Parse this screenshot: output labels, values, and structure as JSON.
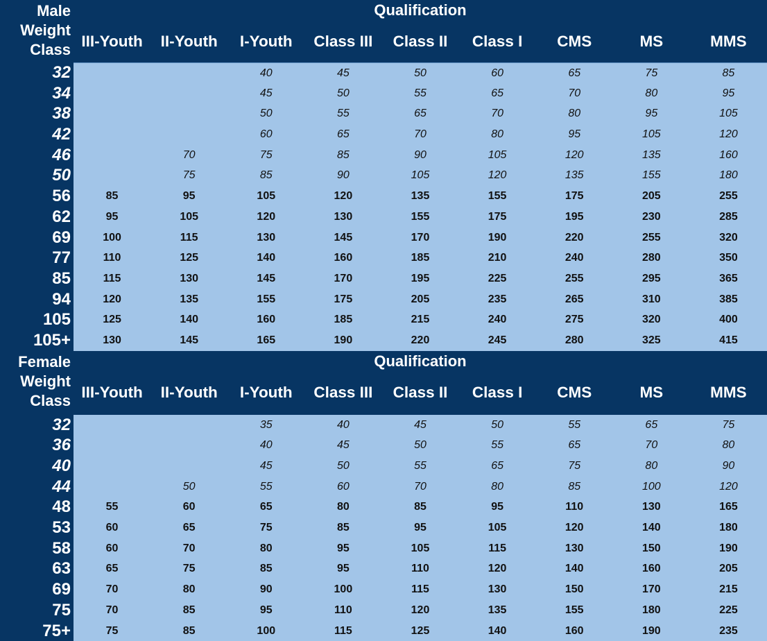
{
  "colors": {
    "header_bg": "#073563",
    "body_bg": "#a2c5e8",
    "header_text": "#ffffff",
    "cell_text": "#111111"
  },
  "qualification_title": "Qualification",
  "columns": [
    "III-Youth",
    "II-Youth",
    "I-Youth",
    "Class III",
    "Class II",
    "Class I",
    "CMS",
    "MS",
    "MMS"
  ],
  "male": {
    "label_lines": [
      "Male",
      "Weight",
      "Class"
    ],
    "qualification_title": "Qualification",
    "rows": [
      {
        "weight": "32",
        "style": "italic",
        "values": [
          "",
          "",
          "40",
          "45",
          "50",
          "60",
          "65",
          "75",
          "85"
        ]
      },
      {
        "weight": "34",
        "style": "italic",
        "values": [
          "",
          "",
          "45",
          "50",
          "55",
          "65",
          "70",
          "80",
          "95"
        ]
      },
      {
        "weight": "38",
        "style": "italic",
        "values": [
          "",
          "",
          "50",
          "55",
          "65",
          "70",
          "80",
          "95",
          "105"
        ]
      },
      {
        "weight": "42",
        "style": "italic",
        "values": [
          "",
          "",
          "60",
          "65",
          "70",
          "80",
          "95",
          "105",
          "120"
        ]
      },
      {
        "weight": "46",
        "style": "italic",
        "values": [
          "",
          "70",
          "75",
          "85",
          "90",
          "105",
          "120",
          "135",
          "160"
        ]
      },
      {
        "weight": "50",
        "style": "italic",
        "values": [
          "",
          "75",
          "85",
          "90",
          "105",
          "120",
          "135",
          "155",
          "180"
        ]
      },
      {
        "weight": "56",
        "style": "bold",
        "values": [
          "85",
          "95",
          "105",
          "120",
          "135",
          "155",
          "175",
          "205",
          "255"
        ]
      },
      {
        "weight": "62",
        "style": "bold",
        "values": [
          "95",
          "105",
          "120",
          "130",
          "155",
          "175",
          "195",
          "230",
          "285"
        ]
      },
      {
        "weight": "69",
        "style": "bold",
        "values": [
          "100",
          "115",
          "130",
          "145",
          "170",
          "190",
          "220",
          "255",
          "320"
        ]
      },
      {
        "weight": "77",
        "style": "bold",
        "values": [
          "110",
          "125",
          "140",
          "160",
          "185",
          "210",
          "240",
          "280",
          "350"
        ]
      },
      {
        "weight": "85",
        "style": "bold",
        "values": [
          "115",
          "130",
          "145",
          "170",
          "195",
          "225",
          "255",
          "295",
          "365"
        ]
      },
      {
        "weight": "94",
        "style": "bold",
        "values": [
          "120",
          "135",
          "155",
          "175",
          "205",
          "235",
          "265",
          "310",
          "385"
        ]
      },
      {
        "weight": "105",
        "style": "bold",
        "values": [
          "125",
          "140",
          "160",
          "185",
          "215",
          "240",
          "275",
          "320",
          "400"
        ]
      },
      {
        "weight": "105+",
        "style": "bold",
        "values": [
          "130",
          "145",
          "165",
          "190",
          "220",
          "245",
          "280",
          "325",
          "415"
        ]
      }
    ]
  },
  "female": {
    "label_lines": [
      "Female",
      "Weight",
      "Class"
    ],
    "qualification_title": "Qualification",
    "rows": [
      {
        "weight": "32",
        "style": "italic",
        "values": [
          "",
          "",
          "35",
          "40",
          "45",
          "50",
          "55",
          "65",
          "75"
        ]
      },
      {
        "weight": "36",
        "style": "italic",
        "values": [
          "",
          "",
          "40",
          "45",
          "50",
          "55",
          "65",
          "70",
          "80"
        ]
      },
      {
        "weight": "40",
        "style": "italic",
        "values": [
          "",
          "",
          "45",
          "50",
          "55",
          "65",
          "75",
          "80",
          "90"
        ]
      },
      {
        "weight": "44",
        "style": "italic",
        "values": [
          "",
          "50",
          "55",
          "60",
          "70",
          "80",
          "85",
          "100",
          "120"
        ]
      },
      {
        "weight": "48",
        "style": "bold",
        "values": [
          "55",
          "60",
          "65",
          "80",
          "85",
          "95",
          "110",
          "130",
          "165"
        ]
      },
      {
        "weight": "53",
        "style": "bold",
        "values": [
          "60",
          "65",
          "75",
          "85",
          "95",
          "105",
          "120",
          "140",
          "180"
        ]
      },
      {
        "weight": "58",
        "style": "bold",
        "values": [
          "60",
          "70",
          "80",
          "95",
          "105",
          "115",
          "130",
          "150",
          "190"
        ]
      },
      {
        "weight": "63",
        "style": "bold",
        "values": [
          "65",
          "75",
          "85",
          "95",
          "110",
          "120",
          "140",
          "160",
          "205"
        ]
      },
      {
        "weight": "69",
        "style": "bold",
        "values": [
          "70",
          "80",
          "90",
          "100",
          "115",
          "130",
          "150",
          "170",
          "215"
        ]
      },
      {
        "weight": "75",
        "style": "bold",
        "values": [
          "70",
          "85",
          "95",
          "110",
          "120",
          "135",
          "155",
          "180",
          "225"
        ]
      },
      {
        "weight": "75+",
        "style": "bold",
        "values": [
          "75",
          "85",
          "100",
          "115",
          "125",
          "140",
          "160",
          "190",
          "235"
        ]
      }
    ]
  }
}
